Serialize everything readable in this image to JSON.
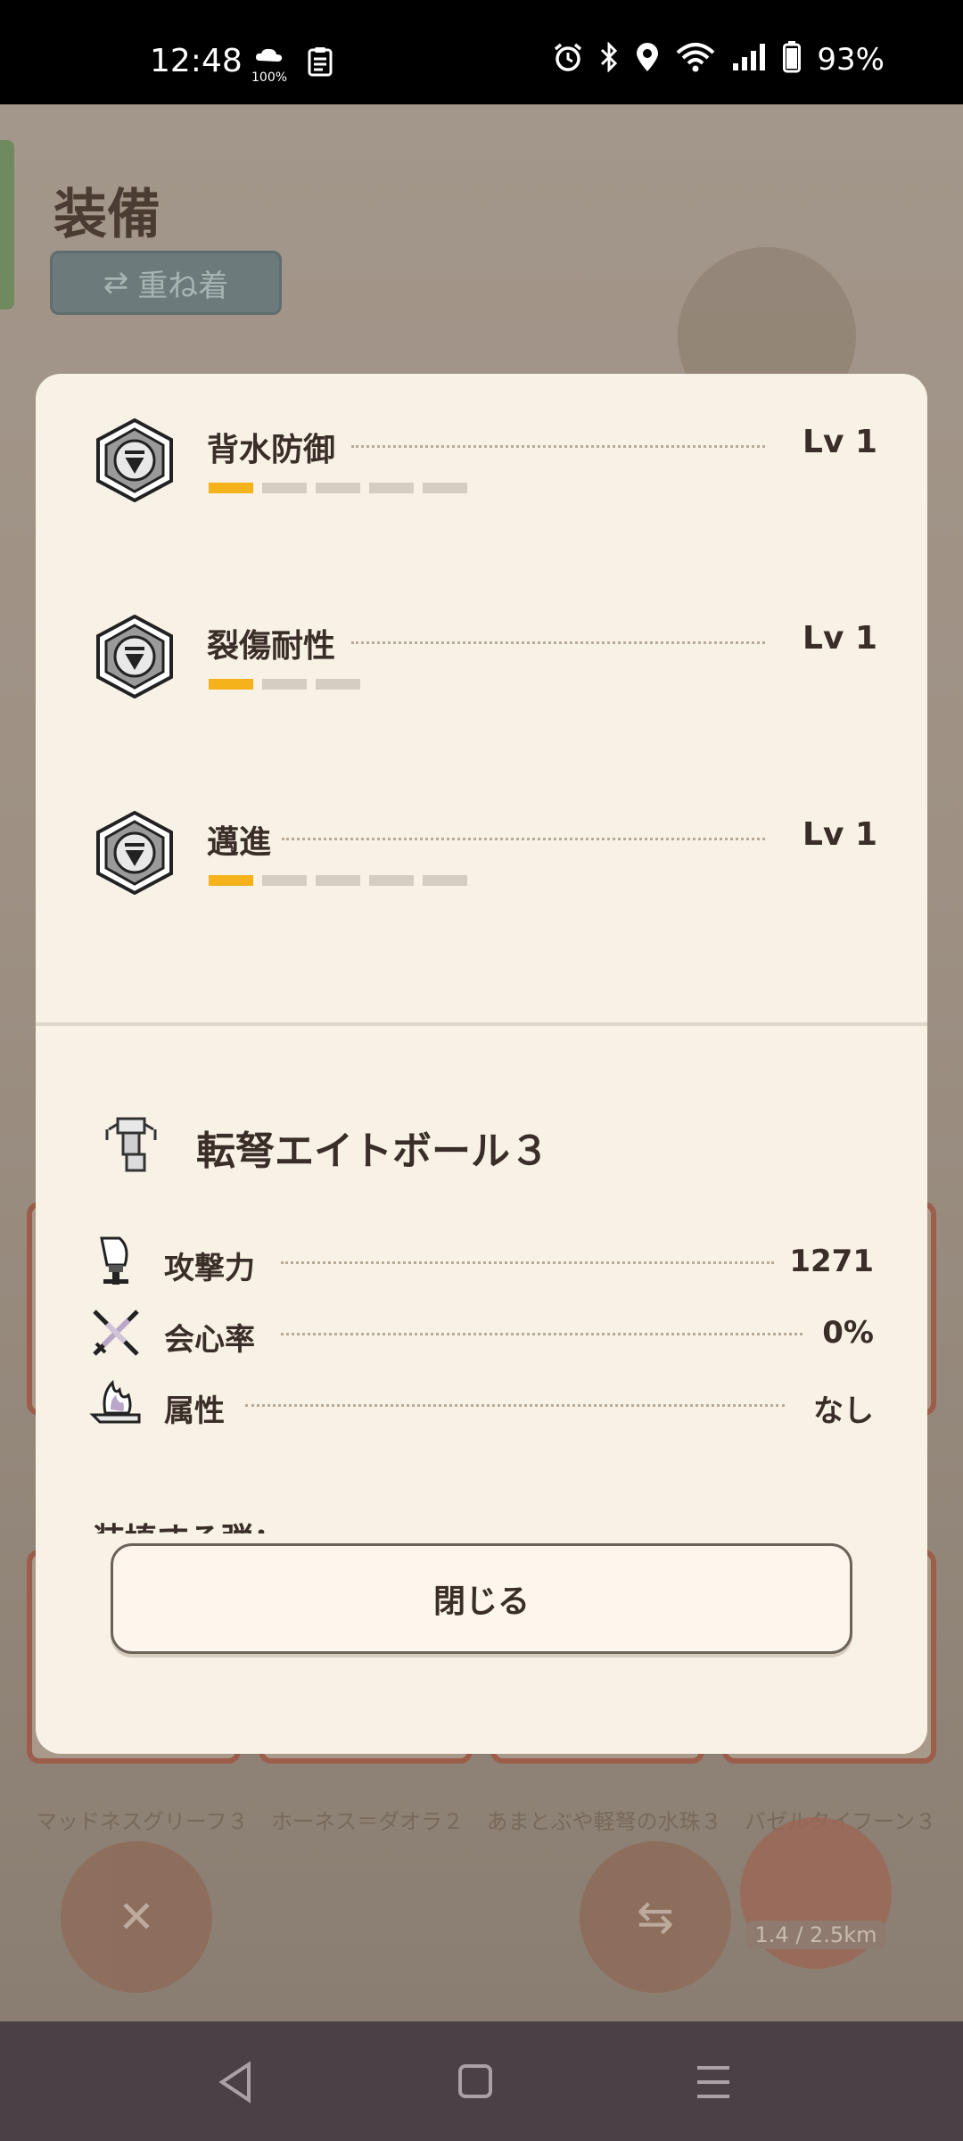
{
  "status_bar": {
    "time": "12:48",
    "weather_badge": "100%",
    "battery": "93%",
    "icons": [
      "weather-icon",
      "clipboard-icon",
      "alarm-icon",
      "bluetooth-icon",
      "location-icon",
      "wifi-icon",
      "signal-icon",
      "battery-icon"
    ]
  },
  "background": {
    "page_title": "装備",
    "layer_button": "重ね着",
    "item_labels": [
      "マッドネスグリーフ３",
      "ホーネス＝ダオラ２",
      "あまとぶや軽弩の水珠３",
      "バゼルタイフーン３"
    ],
    "distance": "1.4 / 2.5km"
  },
  "modal": {
    "skills": [
      {
        "name": "背水防御",
        "level": "Lv 1",
        "filled": 1,
        "total": 5
      },
      {
        "name": "裂傷耐性",
        "level": "Lv 1",
        "filled": 1,
        "total": 3
      },
      {
        "name": "邁進",
        "level": "Lv 1",
        "filled": 1,
        "total": 5
      }
    ],
    "weapon": {
      "name": "転弩エイトボール３",
      "stats": [
        {
          "label": "攻撃力",
          "value": "1271",
          "icon": "sword-icon"
        },
        {
          "label": "会心率",
          "value": "0%",
          "icon": "critical-icon"
        },
        {
          "label": "属性",
          "value": "なし",
          "icon": "element-icon"
        }
      ]
    },
    "cutoff_text": "装填する弾：",
    "close_button": "閉じる"
  },
  "colors": {
    "modal_bg": "#f8f1e6",
    "level_bar_on": "#f5b21a",
    "level_bar_off": "#d6cdc2",
    "text": "#3a2f28"
  }
}
